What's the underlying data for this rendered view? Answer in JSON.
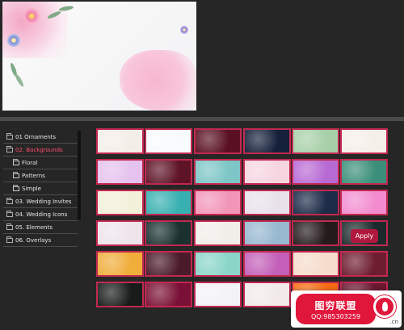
{
  "tree": [
    {
      "label": "01 Ornaments",
      "level": 0,
      "selected": false
    },
    {
      "label": "02. Backgrounds",
      "level": 0,
      "selected": true
    },
    {
      "label": "Floral",
      "level": 1,
      "selected": false
    },
    {
      "label": "Patterns",
      "level": 1,
      "selected": false
    },
    {
      "label": "Simple",
      "level": 1,
      "selected": false
    },
    {
      "label": "03. Wedding Invites",
      "level": 0,
      "selected": false
    },
    {
      "label": "04. Wedding Icons",
      "level": 0,
      "selected": false
    },
    {
      "label": "05. Elements",
      "level": 0,
      "selected": false
    },
    {
      "label": "06. Overlays",
      "level": 0,
      "selected": false
    }
  ],
  "apply_label": "Apply",
  "colors": {
    "accent": "#ff4c69",
    "thumb_border": "#c22850",
    "apply_bg": "#b0183d"
  },
  "thumbnails": [
    [
      "#f4eee8",
      "#f8fbfc",
      "#5a1022",
      "#15203a",
      "#a7d0a8",
      "#f5efe9"
    ],
    [
      "#e6c2ee",
      "#5e1326",
      "#7dc5c6",
      "#f6d5e0",
      "#b86ad4",
      "#3b8f7a"
    ],
    [
      "#f3f0da",
      "#38b0b1",
      "#f295b7",
      "#e8e1ea",
      "#1c2b47",
      "#f28ccf"
    ],
    [
      "#eee4ec",
      "#1a3130",
      "#f1eee9",
      "#97b8cf",
      "#241a1c",
      "#1d2a2c"
    ],
    [
      "#f0ad3a",
      "#4a1a2a",
      "#8ad5c8",
      "#c35fb8",
      "#f5dccc",
      "#6e1c2f"
    ],
    [
      "#171c1a",
      "#7a1035",
      "#f3f2f6",
      "#f2eaea",
      "#f56c14",
      "#6a1730"
    ]
  ],
  "watermark": {
    "title": "图穷联盟",
    "qq": "QQ:985303259",
    "suffix": ".cn"
  }
}
